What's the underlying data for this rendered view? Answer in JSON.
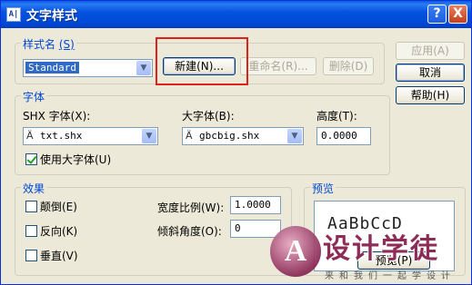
{
  "window": {
    "title": "文字样式",
    "icon": "AutoCAD-A-icon",
    "help_btn": "?",
    "close_btn": "X"
  },
  "style_group": {
    "label": "样式名",
    "hotkey": "(S)",
    "selected_style": "Standard",
    "new_btn": "新建(N)...",
    "rename_btn": "重命名(R)...",
    "delete_btn": "删除(D)"
  },
  "side_buttons": {
    "apply": "应用(A)",
    "cancel": "取消",
    "help": "帮助(H)"
  },
  "font_group": {
    "label": "字体",
    "shx_label": "SHX 字体(X):",
    "shx_value": "txt.shx",
    "bigfont_label": "大字体(B):",
    "bigfont_value": "gbcbig.shx",
    "height_label": "高度(T):",
    "height_value": "0.0000",
    "use_bigfont_label": "使用大字体(U)",
    "use_bigfont_checked": true
  },
  "effects_group": {
    "label": "效果",
    "upside_down": "颠倒(E)",
    "backwards": "反向(K)",
    "vertical": "垂直(V)",
    "width_factor_label": "宽度比例(W):",
    "width_factor_value": "1.0000",
    "oblique_label": "倾斜角度(O):",
    "oblique_value": "0"
  },
  "preview_group": {
    "label": "预览",
    "sample": "AaBbCcD",
    "preview_btn": "预览(P)"
  },
  "watermark": {
    "logo_letter": "A",
    "title": "设计学徒",
    "subtitle": "来和我们一起学设计"
  },
  "colors": {
    "titlebar": "#0553e0",
    "group_label": "#0046d5",
    "highlight": "#e0201a",
    "watermark": "#8e2c58"
  }
}
